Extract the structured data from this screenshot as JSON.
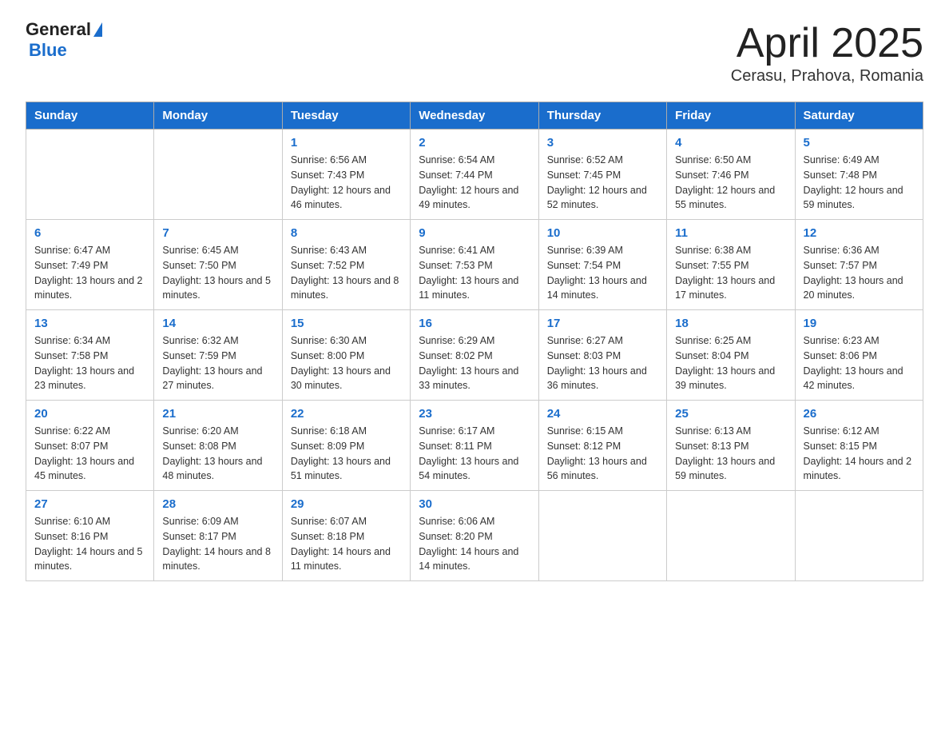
{
  "header": {
    "logo_general": "General",
    "logo_blue": "Blue",
    "title": "April 2025",
    "subtitle": "Cerasu, Prahova, Romania"
  },
  "calendar": {
    "days_of_week": [
      "Sunday",
      "Monday",
      "Tuesday",
      "Wednesday",
      "Thursday",
      "Friday",
      "Saturday"
    ],
    "weeks": [
      [
        {
          "num": "",
          "info": ""
        },
        {
          "num": "",
          "info": ""
        },
        {
          "num": "1",
          "info": "Sunrise: 6:56 AM\nSunset: 7:43 PM\nDaylight: 12 hours\nand 46 minutes."
        },
        {
          "num": "2",
          "info": "Sunrise: 6:54 AM\nSunset: 7:44 PM\nDaylight: 12 hours\nand 49 minutes."
        },
        {
          "num": "3",
          "info": "Sunrise: 6:52 AM\nSunset: 7:45 PM\nDaylight: 12 hours\nand 52 minutes."
        },
        {
          "num": "4",
          "info": "Sunrise: 6:50 AM\nSunset: 7:46 PM\nDaylight: 12 hours\nand 55 minutes."
        },
        {
          "num": "5",
          "info": "Sunrise: 6:49 AM\nSunset: 7:48 PM\nDaylight: 12 hours\nand 59 minutes."
        }
      ],
      [
        {
          "num": "6",
          "info": "Sunrise: 6:47 AM\nSunset: 7:49 PM\nDaylight: 13 hours\nand 2 minutes."
        },
        {
          "num": "7",
          "info": "Sunrise: 6:45 AM\nSunset: 7:50 PM\nDaylight: 13 hours\nand 5 minutes."
        },
        {
          "num": "8",
          "info": "Sunrise: 6:43 AM\nSunset: 7:52 PM\nDaylight: 13 hours\nand 8 minutes."
        },
        {
          "num": "9",
          "info": "Sunrise: 6:41 AM\nSunset: 7:53 PM\nDaylight: 13 hours\nand 11 minutes."
        },
        {
          "num": "10",
          "info": "Sunrise: 6:39 AM\nSunset: 7:54 PM\nDaylight: 13 hours\nand 14 minutes."
        },
        {
          "num": "11",
          "info": "Sunrise: 6:38 AM\nSunset: 7:55 PM\nDaylight: 13 hours\nand 17 minutes."
        },
        {
          "num": "12",
          "info": "Sunrise: 6:36 AM\nSunset: 7:57 PM\nDaylight: 13 hours\nand 20 minutes."
        }
      ],
      [
        {
          "num": "13",
          "info": "Sunrise: 6:34 AM\nSunset: 7:58 PM\nDaylight: 13 hours\nand 23 minutes."
        },
        {
          "num": "14",
          "info": "Sunrise: 6:32 AM\nSunset: 7:59 PM\nDaylight: 13 hours\nand 27 minutes."
        },
        {
          "num": "15",
          "info": "Sunrise: 6:30 AM\nSunset: 8:00 PM\nDaylight: 13 hours\nand 30 minutes."
        },
        {
          "num": "16",
          "info": "Sunrise: 6:29 AM\nSunset: 8:02 PM\nDaylight: 13 hours\nand 33 minutes."
        },
        {
          "num": "17",
          "info": "Sunrise: 6:27 AM\nSunset: 8:03 PM\nDaylight: 13 hours\nand 36 minutes."
        },
        {
          "num": "18",
          "info": "Sunrise: 6:25 AM\nSunset: 8:04 PM\nDaylight: 13 hours\nand 39 minutes."
        },
        {
          "num": "19",
          "info": "Sunrise: 6:23 AM\nSunset: 8:06 PM\nDaylight: 13 hours\nand 42 minutes."
        }
      ],
      [
        {
          "num": "20",
          "info": "Sunrise: 6:22 AM\nSunset: 8:07 PM\nDaylight: 13 hours\nand 45 minutes."
        },
        {
          "num": "21",
          "info": "Sunrise: 6:20 AM\nSunset: 8:08 PM\nDaylight: 13 hours\nand 48 minutes."
        },
        {
          "num": "22",
          "info": "Sunrise: 6:18 AM\nSunset: 8:09 PM\nDaylight: 13 hours\nand 51 minutes."
        },
        {
          "num": "23",
          "info": "Sunrise: 6:17 AM\nSunset: 8:11 PM\nDaylight: 13 hours\nand 54 minutes."
        },
        {
          "num": "24",
          "info": "Sunrise: 6:15 AM\nSunset: 8:12 PM\nDaylight: 13 hours\nand 56 minutes."
        },
        {
          "num": "25",
          "info": "Sunrise: 6:13 AM\nSunset: 8:13 PM\nDaylight: 13 hours\nand 59 minutes."
        },
        {
          "num": "26",
          "info": "Sunrise: 6:12 AM\nSunset: 8:15 PM\nDaylight: 14 hours\nand 2 minutes."
        }
      ],
      [
        {
          "num": "27",
          "info": "Sunrise: 6:10 AM\nSunset: 8:16 PM\nDaylight: 14 hours\nand 5 minutes."
        },
        {
          "num": "28",
          "info": "Sunrise: 6:09 AM\nSunset: 8:17 PM\nDaylight: 14 hours\nand 8 minutes."
        },
        {
          "num": "29",
          "info": "Sunrise: 6:07 AM\nSunset: 8:18 PM\nDaylight: 14 hours\nand 11 minutes."
        },
        {
          "num": "30",
          "info": "Sunrise: 6:06 AM\nSunset: 8:20 PM\nDaylight: 14 hours\nand 14 minutes."
        },
        {
          "num": "",
          "info": ""
        },
        {
          "num": "",
          "info": ""
        },
        {
          "num": "",
          "info": ""
        }
      ]
    ]
  }
}
